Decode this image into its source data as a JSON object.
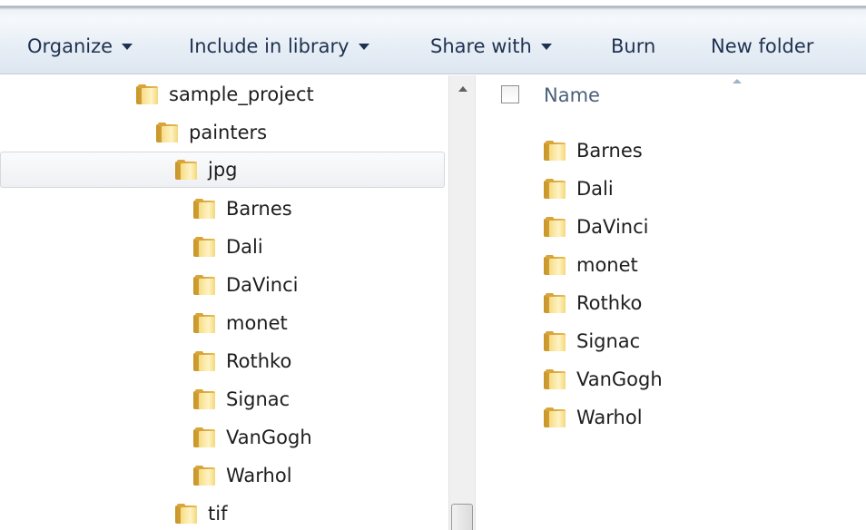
{
  "toolbar": {
    "organize": "Organize",
    "include_in_library": "Include in library",
    "share_with": "Share with",
    "burn": "Burn",
    "new_folder": "New folder"
  },
  "navigation_tree": {
    "items": [
      {
        "label": "sample_project"
      },
      {
        "label": "painters"
      },
      {
        "label": "jpg",
        "selected": true
      },
      {
        "label": "Barnes"
      },
      {
        "label": "Dali"
      },
      {
        "label": "DaVinci"
      },
      {
        "label": "monet"
      },
      {
        "label": "Rothko"
      },
      {
        "label": "Signac"
      },
      {
        "label": "VanGogh"
      },
      {
        "label": "Warhol"
      },
      {
        "label": "tif"
      }
    ]
  },
  "file_list": {
    "column_name": "Name",
    "items": [
      {
        "label": "Barnes"
      },
      {
        "label": "Dali"
      },
      {
        "label": "DaVinci"
      },
      {
        "label": "monet"
      },
      {
        "label": "Rothko"
      },
      {
        "label": "Signac"
      },
      {
        "label": "VanGogh"
      },
      {
        "label": "Warhol"
      }
    ]
  },
  "icons": {
    "folder": "folder-icon",
    "caret": "caret-down-icon",
    "sort": "sort-up-icon",
    "scroll_up": "scroll-up-arrow-icon"
  },
  "colors": {
    "toolbar_text": "#1e3250",
    "header_text": "#4c607a",
    "folder": "#e9bd55"
  }
}
